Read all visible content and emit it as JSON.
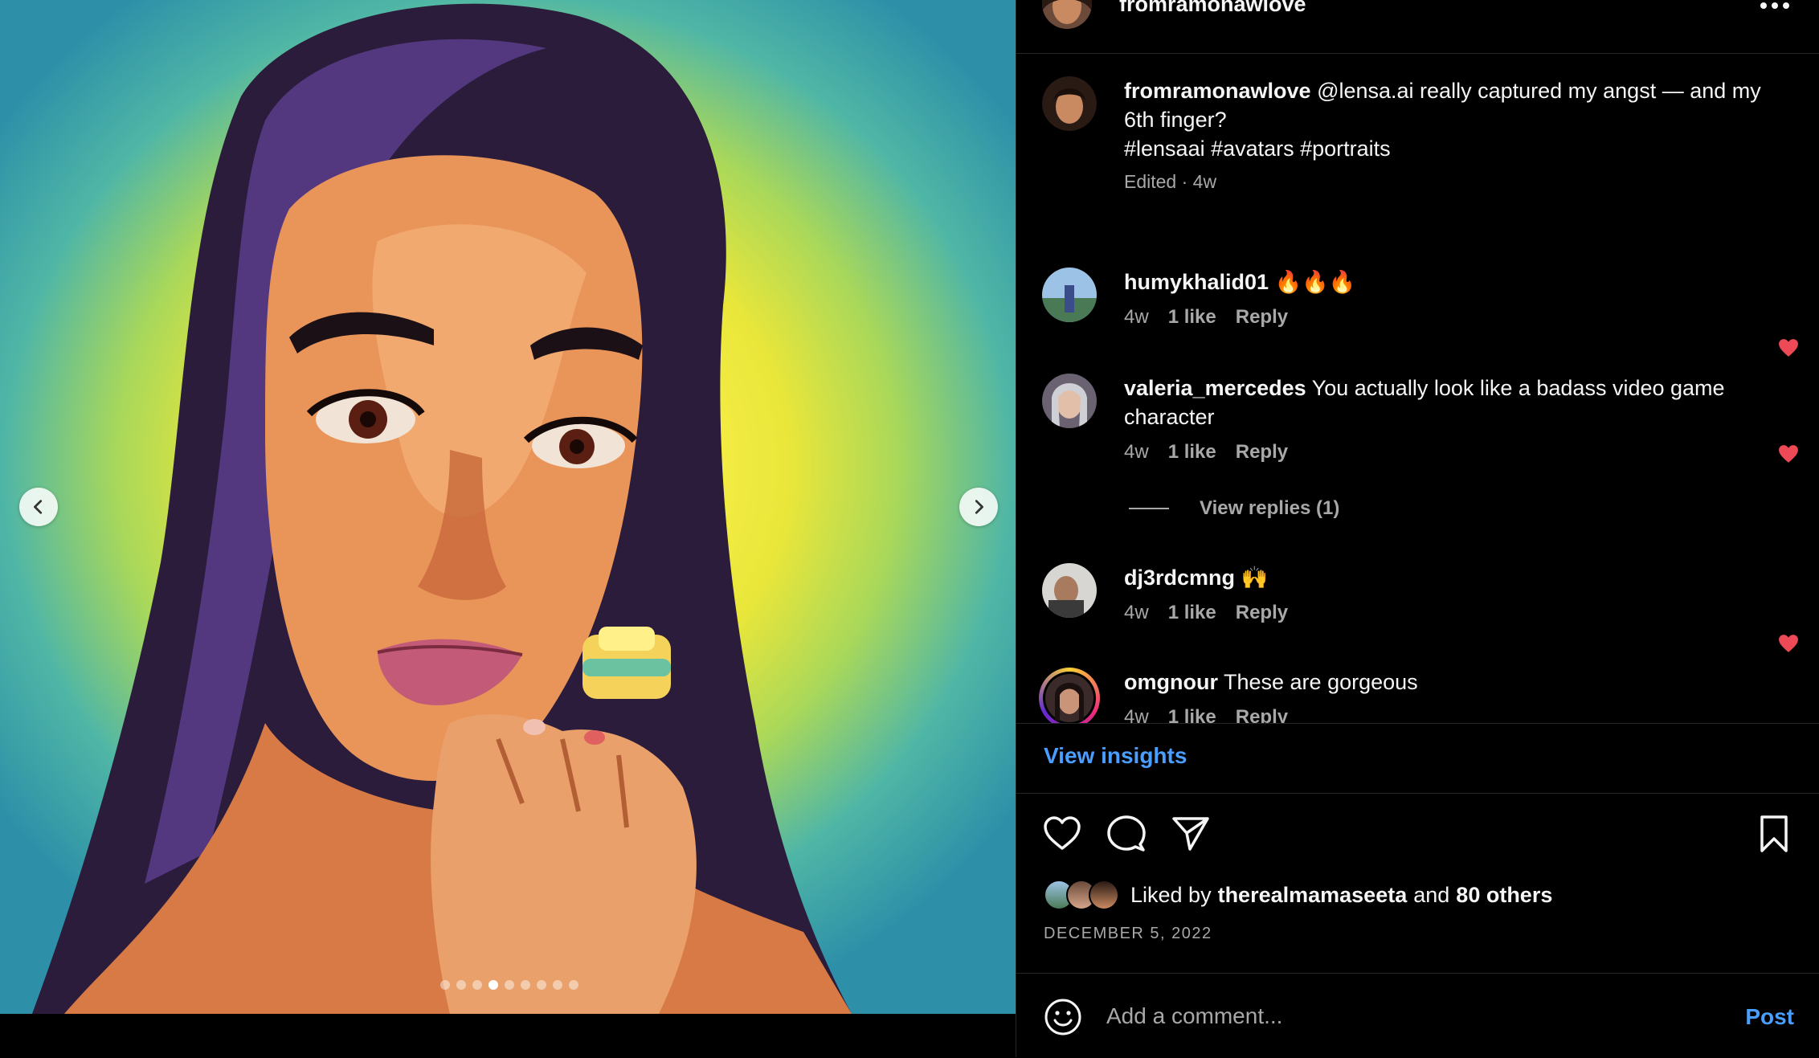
{
  "post": {
    "username": "fromramonawlove",
    "carousel": {
      "count": 9,
      "active_index": 3
    }
  },
  "caption": {
    "username": "fromramonawlove",
    "text": "@lensa.ai really captured my angst — and my 6th finger?",
    "hashtags": "#lensaai #avatars #portraits",
    "edited": "Edited · 4w"
  },
  "comments": [
    {
      "username": "humykhalid01",
      "text": "🔥🔥🔥",
      "age": "4w",
      "likes": "1 like",
      "reply": "Reply"
    },
    {
      "username": "valeria_mercedes",
      "text": "You actually look like a badass video game character",
      "age": "4w",
      "likes": "1 like",
      "reply": "Reply",
      "view_replies": "View replies (1)"
    },
    {
      "username": "dj3rdcmng",
      "text": "🙌",
      "age": "4w",
      "likes": "1 like",
      "reply": "Reply"
    },
    {
      "username": "omgnour",
      "text": "These are gorgeous",
      "age": "4w",
      "likes": "1 like",
      "reply": "Reply"
    }
  ],
  "insights_label": "View insights",
  "likes": {
    "prefix": "Liked by",
    "user": "therealmamaseeta",
    "conjunction": "and",
    "others": "80 others"
  },
  "date": "DECEMBER 5, 2022",
  "comment_box": {
    "placeholder": "Add a comment...",
    "post_label": "Post"
  },
  "colors": {
    "accent": "#4a9eff",
    "heart": "#ed4956",
    "background": "#000000",
    "muted": "#a8a8a8"
  },
  "icons": [
    "chevron-left-icon",
    "chevron-right-icon",
    "more-icon",
    "heart-icon",
    "comment-icon",
    "share-icon",
    "bookmark-icon",
    "emoji-icon"
  ]
}
